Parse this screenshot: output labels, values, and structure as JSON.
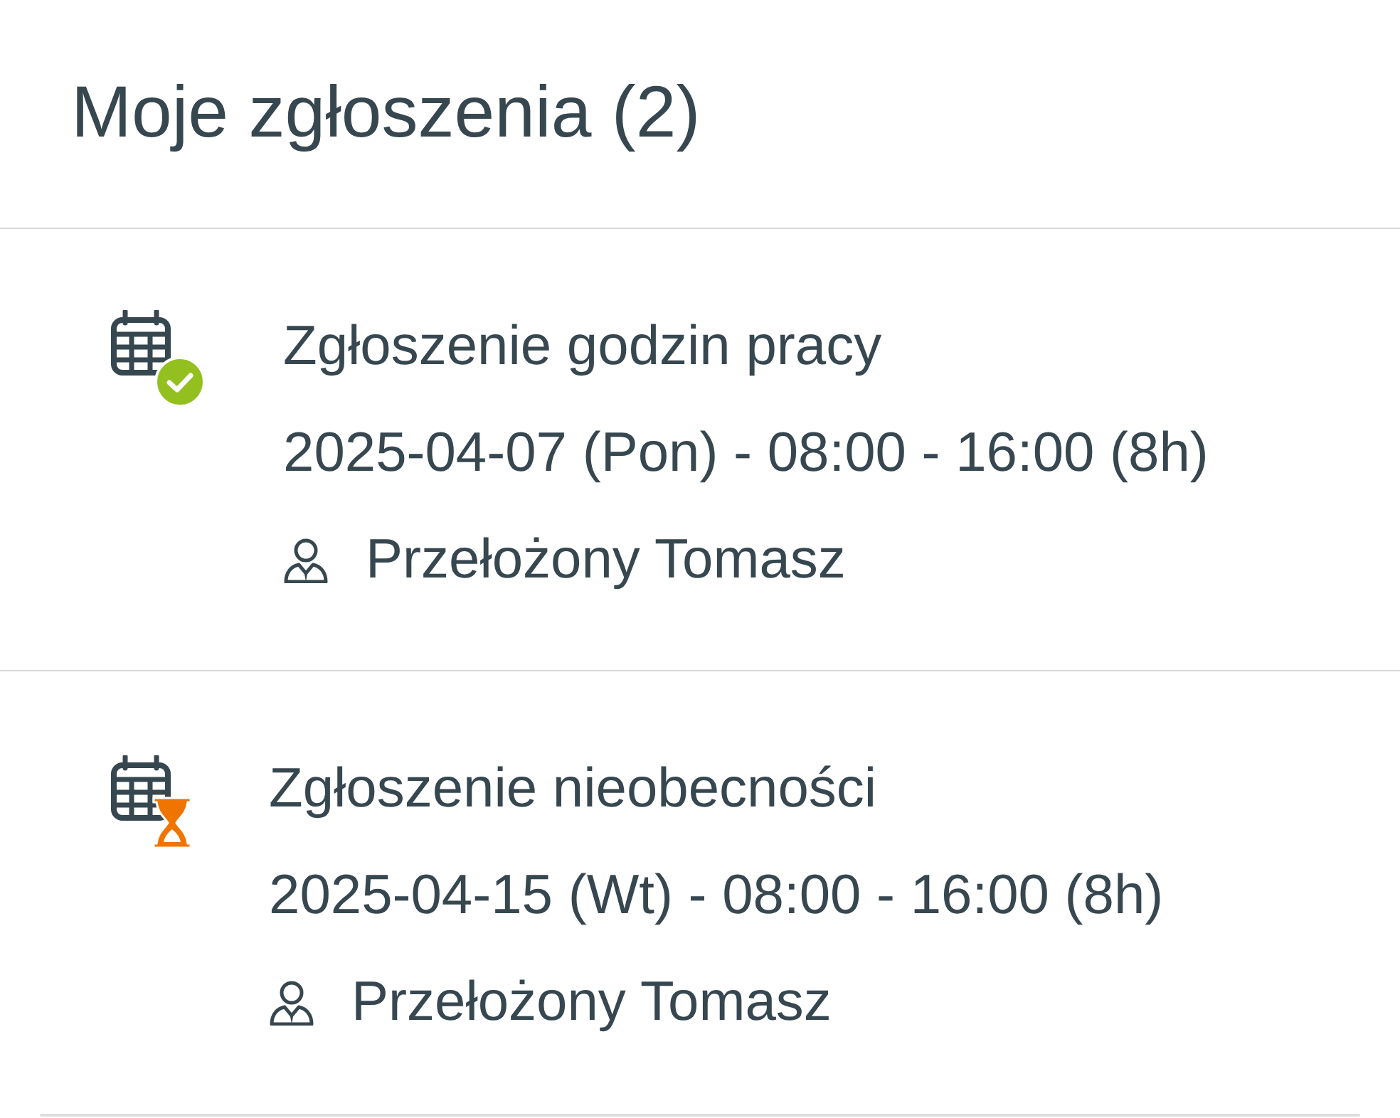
{
  "header": {
    "title": "Moje zgłoszenia (2)"
  },
  "requests": [
    {
      "kind": "approved",
      "title": "Zgłoszenie godzin pracy",
      "period": "2025-04-07 (Pon) - 08:00 - 16:00 (8h)",
      "approver": "Przełożony Tomasz"
    },
    {
      "kind": "pending",
      "title": "Zgłoszenie nieobecności",
      "period": "2025-04-15 (Wt) - 08:00 - 16:00 (8h)",
      "approver": "Przełożony Tomasz"
    }
  ]
}
